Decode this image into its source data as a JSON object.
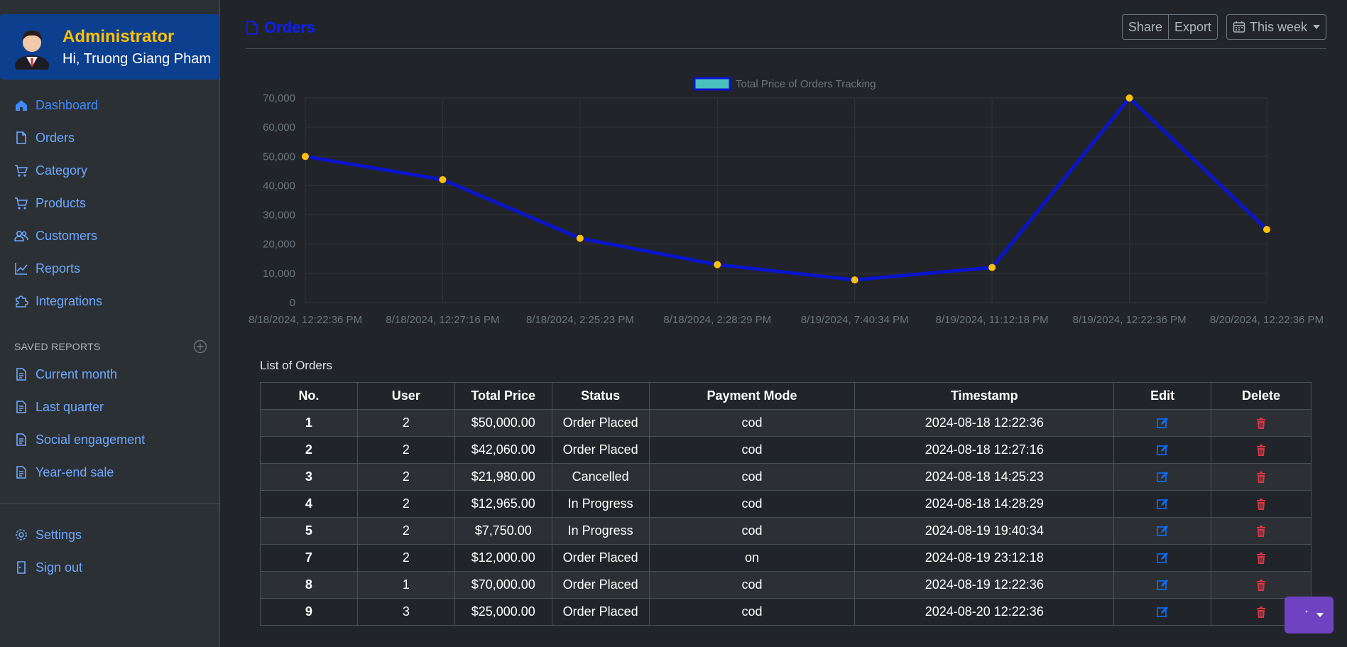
{
  "profile": {
    "role": "Administrator",
    "greeting": "Hi, Truong Giang Pham"
  },
  "nav": [
    {
      "label": "Dashboard",
      "icon": "home-icon"
    },
    {
      "label": "Orders",
      "icon": "file-icon"
    },
    {
      "label": "Category",
      "icon": "cart-icon"
    },
    {
      "label": "Products",
      "icon": "cart-icon"
    },
    {
      "label": "Customers",
      "icon": "users-icon"
    },
    {
      "label": "Reports",
      "icon": "chart-line-icon"
    },
    {
      "label": "Integrations",
      "icon": "puzzle-icon"
    }
  ],
  "saved_reports": {
    "header": "SAVED REPORTS",
    "items": [
      {
        "label": "Current month",
        "icon": "file-text-icon"
      },
      {
        "label": "Last quarter",
        "icon": "file-text-icon"
      },
      {
        "label": "Social engagement",
        "icon": "file-text-icon"
      },
      {
        "label": "Year-end sale",
        "icon": "file-text-icon"
      }
    ]
  },
  "footer_nav": [
    {
      "label": "Settings",
      "icon": "gear-icon"
    },
    {
      "label": "Sign out",
      "icon": "sign-out-icon"
    }
  ],
  "header": {
    "title": "Orders",
    "share": "Share",
    "export": "Export",
    "week": "This week"
  },
  "chart_data": {
    "type": "line",
    "legend": "Total Price of Orders Tracking",
    "legend_position": "top",
    "x": [
      "8/18/2024, 12:22:36 PM",
      "8/18/2024, 12:27:16 PM",
      "8/18/2024, 2:25:23 PM",
      "8/18/2024, 2:28:29 PM",
      "8/19/2024, 7:40:34 PM",
      "8/19/2024, 11:12:18 PM",
      "8/19/2024, 12:22:36 PM",
      "8/20/2024, 12:22:36 PM"
    ],
    "series": [
      {
        "name": "Total Price of Orders Tracking",
        "values": [
          50000,
          42060,
          21980,
          12965,
          7750,
          12000,
          70000,
          25000
        ]
      }
    ],
    "ylim": [
      0,
      70000
    ],
    "yticks": [
      "0",
      "10,000",
      "20,000",
      "30,000",
      "40,000",
      "50,000",
      "60,000",
      "70,000"
    ],
    "grid": true,
    "colors": {
      "line": "#0a14c8",
      "point": "#ffc107",
      "legend_fill": "#4bc0c0"
    }
  },
  "table": {
    "caption": "List of Orders",
    "columns": [
      "No.",
      "User",
      "Total Price",
      "Status",
      "Payment Mode",
      "Timestamp",
      "Edit",
      "Delete"
    ],
    "rows": [
      [
        "1",
        "2",
        "$50,000.00",
        "Order Placed",
        "cod",
        "2024-08-18 12:22:36"
      ],
      [
        "2",
        "2",
        "$42,060.00",
        "Order Placed",
        "cod",
        "2024-08-18 12:27:16"
      ],
      [
        "3",
        "2",
        "$21,980.00",
        "Cancelled",
        "cod",
        "2024-08-18 14:25:23"
      ],
      [
        "4",
        "2",
        "$12,965.00",
        "In Progress",
        "cod",
        "2024-08-18 14:28:29"
      ],
      [
        "5",
        "2",
        "$7,750.00",
        "In Progress",
        "cod",
        "2024-08-19 19:40:34"
      ],
      [
        "7",
        "2",
        "$12,000.00",
        "Order Placed",
        "on",
        "2024-08-19 23:12:18"
      ],
      [
        "8",
        "1",
        "$70,000.00",
        "Order Placed",
        "cod",
        "2024-08-19 12:22:36"
      ],
      [
        "9",
        "3",
        "$25,000.00",
        "Order Placed",
        "cod",
        "2024-08-20 12:22:36"
      ]
    ]
  },
  "colors": {
    "accent": "#6ea8fe",
    "title": "#0d1dff",
    "role": "#ffc107",
    "edit": "#0d6efd",
    "delete": "#dc3545",
    "theme_button": "#6f42c1"
  }
}
